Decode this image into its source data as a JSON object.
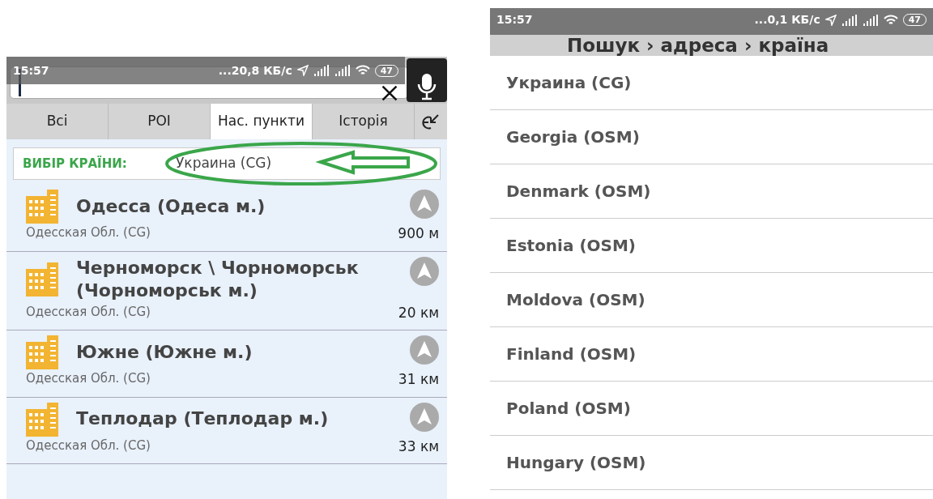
{
  "left_screen": {
    "status_bar": {
      "time": "15:57",
      "speed": "...20,8 КБ/с",
      "battery": "47"
    },
    "tabs": [
      {
        "label": "Всі",
        "selected": false
      },
      {
        "label": "POI",
        "selected": false
      },
      {
        "label": "Нас. пункти",
        "selected": true
      },
      {
        "label": "Історія",
        "selected": false
      }
    ],
    "country_selector": {
      "label": "ВИБІР КРАЇНИ:",
      "value": "Украина (CG)"
    },
    "results": [
      {
        "title": "Одесса (Одеса м.)",
        "region": "Одесская Обл. (CG)",
        "distance": "900 м"
      },
      {
        "title": "Черноморск \\ Чорноморськ (Чорноморськ м.)",
        "region": "Одесская Обл. (CG)",
        "distance": "20 км"
      },
      {
        "title": "Южне (Южне м.)",
        "region": "Одесская Обл. (CG)",
        "distance": "31 км"
      },
      {
        "title": "Теплодар (Теплодар м.)",
        "region": "Одесская Обл. (CG)",
        "distance": "33 км"
      }
    ]
  },
  "right_screen": {
    "status_bar": {
      "time": "15:57",
      "speed": "...0,1 КБ/с",
      "battery": "47"
    },
    "title": "Пошук › адреса › країна",
    "countries": [
      "Украина (CG)",
      "Georgia (OSM)",
      "Denmark (OSM)",
      "Estonia (OSM)",
      "Moldova (OSM)",
      "Finland (OSM)",
      "Poland (OSM)",
      "Hungary (OSM)"
    ]
  }
}
